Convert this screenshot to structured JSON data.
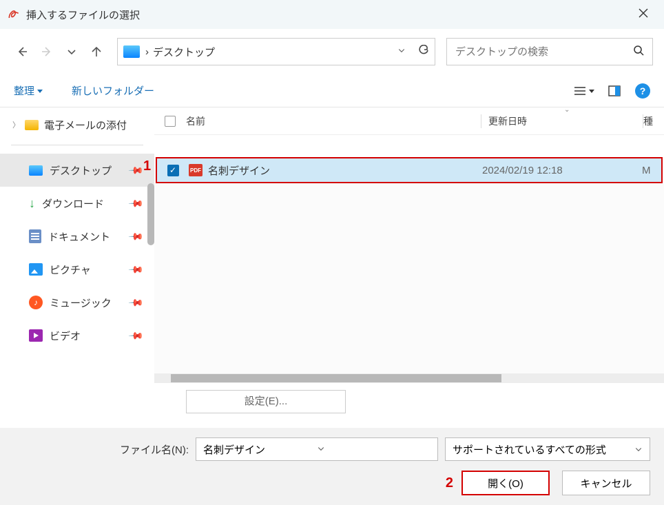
{
  "titlebar": {
    "title": "挿入するファイルの選択"
  },
  "address": {
    "crumb_sep": "›",
    "location": "デスクトップ"
  },
  "search": {
    "placeholder": "デスクトップの検索"
  },
  "toolbar": {
    "organize": "整理",
    "new_folder": "新しいフォルダー"
  },
  "sidebar": {
    "tree_node": "電子メールの添付",
    "items": [
      {
        "label": "デスクトップ"
      },
      {
        "label": "ダウンロード"
      },
      {
        "label": "ドキュメント"
      },
      {
        "label": "ピクチャ"
      },
      {
        "label": "ミュージック"
      },
      {
        "label": "ビデオ"
      }
    ]
  },
  "list": {
    "headers": {
      "name": "名前",
      "date": "更新日時",
      "type": "種"
    },
    "row": {
      "pdf_badge": "PDF",
      "name": "名刺デザイン",
      "date": "2024/02/19 12:18",
      "type": "M"
    }
  },
  "settings_btn": "設定(E)...",
  "bottom": {
    "filename_label": "ファイル名(N):",
    "filename_value": "名刺デザイン",
    "filter": "サポートされているすべての形式",
    "open": "開く(O)",
    "cancel": "キャンセル"
  },
  "annotations": {
    "one": "1",
    "two": "2"
  }
}
